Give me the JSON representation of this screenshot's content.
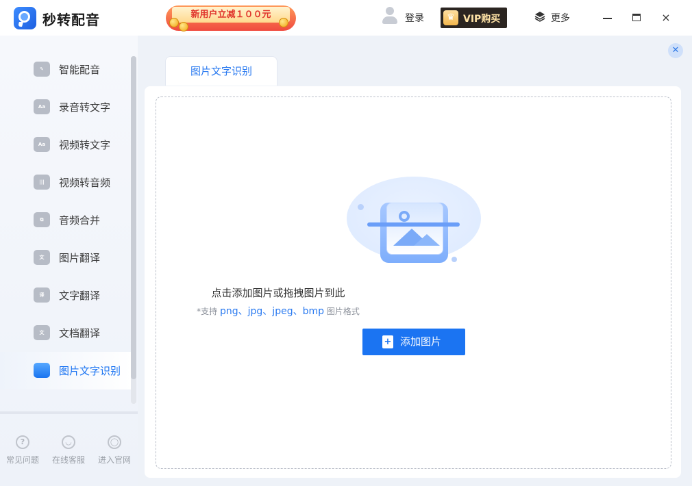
{
  "app": {
    "title": "秒转配音"
  },
  "header": {
    "promo_text": "新用户立减１００元",
    "login_label": "登录",
    "vip_label": "VIP购买",
    "more_label": "更多",
    "minimize": "minimize",
    "maximize": "maximize",
    "close": "×"
  },
  "sidebar": {
    "items": [
      {
        "label": "智能配音",
        "icon": "mic-icon",
        "glyph": "✎"
      },
      {
        "label": "录音转文字",
        "icon": "speech-to-text-icon",
        "glyph": "Aa"
      },
      {
        "label": "视频转文字",
        "icon": "video-to-text-icon",
        "glyph": "Aa"
      },
      {
        "label": "视频转音频",
        "icon": "video-to-audio-icon",
        "glyph": "|||"
      },
      {
        "label": "音频合并",
        "icon": "merge-icon",
        "glyph": "⧉"
      },
      {
        "label": "图片翻译",
        "icon": "image-translate-icon",
        "glyph": "文"
      },
      {
        "label": "文字翻译",
        "icon": "text-translate-icon",
        "glyph": "译"
      },
      {
        "label": "文档翻译",
        "icon": "document-translate-icon",
        "glyph": "文"
      },
      {
        "label": "图片文字识别",
        "icon": "ocr-icon",
        "glyph": "",
        "active": true
      }
    ],
    "bottom": [
      {
        "label": "常见问题",
        "icon": "help-icon",
        "glyph": "?"
      },
      {
        "label": "在线客服",
        "icon": "support-icon",
        "glyph": "◡"
      },
      {
        "label": "进入官网",
        "icon": "website-icon",
        "glyph": "◯"
      }
    ]
  },
  "main": {
    "tab_label": "图片文字识别",
    "close_glyph": "✕",
    "hint_main": "点击添加图片或拖拽图片到此",
    "hint_prefix": "*支持 ",
    "hint_formats": "png、jpg、jpeg、bmp",
    "hint_suffix": " 图片格式",
    "add_button_label": "添加图片",
    "add_button_glyph": "+"
  },
  "colors": {
    "accent": "#1b74f2",
    "vip_bg": "#2b2521",
    "promo": "#f04a3f"
  }
}
